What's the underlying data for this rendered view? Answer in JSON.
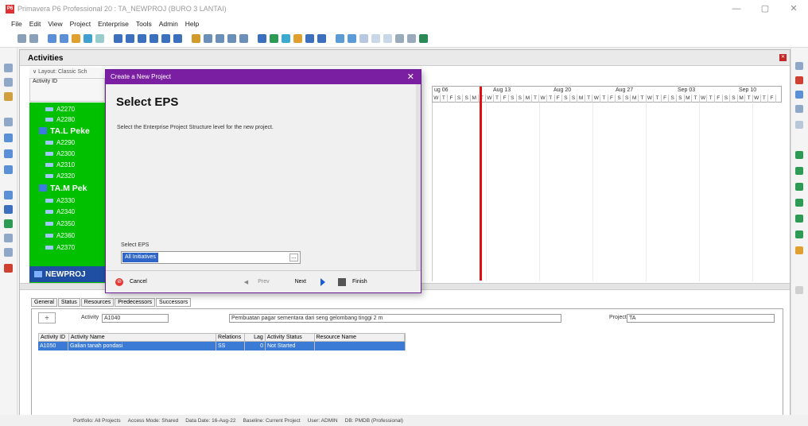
{
  "window": {
    "title": "Primavera P6 Professional 20 : TA_NEWPROJ (BURO 3 LANTAI)",
    "icon_text": "P6",
    "min": "—",
    "max": "▢",
    "close": "✕"
  },
  "menu": [
    "File",
    "Edit",
    "View",
    "Project",
    "Enterprise",
    "Tools",
    "Admin",
    "Help"
  ],
  "activities": {
    "title": "Activities",
    "close": "✕",
    "layout_label": "∨ Layout: Classic Sch",
    "col_header": "Activity ID",
    "rows": [
      {
        "id": "A2270",
        "type": "task"
      },
      {
        "id": "A2280",
        "type": "task"
      },
      {
        "id": "TA.L Peke",
        "type": "group"
      },
      {
        "id": "A2290",
        "type": "task"
      },
      {
        "id": "A2300",
        "type": "task"
      },
      {
        "id": "A2310",
        "type": "task"
      },
      {
        "id": "A2320",
        "type": "task"
      },
      {
        "id": "TA.M Pek",
        "type": "group"
      },
      {
        "id": "A2330",
        "type": "task"
      },
      {
        "id": "A2340",
        "type": "task"
      },
      {
        "id": "A2350",
        "type": "task"
      },
      {
        "id": "A2360",
        "type": "task"
      },
      {
        "id": "A2370",
        "type": "task"
      }
    ],
    "project_group": "NEWPROJ"
  },
  "gantt": {
    "months": [
      "ug 06",
      "Aug 13",
      "Aug 20",
      "Aug 27",
      "Sep 03",
      "Sep 10"
    ],
    "days": [
      "W",
      "T",
      "F",
      "S",
      "S",
      "M",
      "T",
      "W",
      "T",
      "F",
      "S",
      "S",
      "M",
      "T",
      "W",
      "T",
      "F",
      "S",
      "S",
      "M",
      "T",
      "W",
      "T",
      "F",
      "S",
      "S",
      "M",
      "T",
      "W",
      "T",
      "F",
      "S",
      "S",
      "M",
      "T",
      "W",
      "T",
      "F",
      "S",
      "S",
      "M",
      "T",
      "W",
      "T",
      "F"
    ]
  },
  "details": {
    "tabs": [
      "General",
      "Status",
      "Resources",
      "Predecessors",
      "Successors"
    ],
    "active_tab": "Successors",
    "activity_label": "Activity",
    "activity_value": "A1040",
    "activity_name": "Pembuatan pagar sementara dari seng gelombang tinggi 2 m",
    "project_label": "Project",
    "project_value": "TA",
    "table_headers": [
      "Activity ID",
      "Activity Name",
      "Relations",
      "Lag",
      "Activity Status",
      "Resource Name"
    ],
    "table_rows": [
      {
        "id": "A1050",
        "name": "Galian tanah pondasi",
        "rel": "SS",
        "lag": "0",
        "status": "Not Started",
        "resource": ""
      }
    ]
  },
  "statusbar": [
    "Portfolio: All Projects",
    "Access Mode: Shared",
    "Data Date: 16-Aug-22",
    "Baseline: Current Project",
    "User: ADMIN",
    "DB: PMDB (Professional)"
  ],
  "dialog": {
    "title": "Create a New Project",
    "close": "✕",
    "heading": "Select EPS",
    "description": "Select the Enterprise Project Structure level for the new project.",
    "eps_label": "Select EPS",
    "eps_value": "All Initiatives",
    "cancel": "Cancel",
    "prev": "Prev",
    "next": "Next",
    "finish": "Finish"
  },
  "colors": {
    "dialog_title": "#7b1fa2",
    "tree_bg": "#00c000",
    "selection": "#3b7bd6",
    "data_date_line": "#e01010"
  }
}
